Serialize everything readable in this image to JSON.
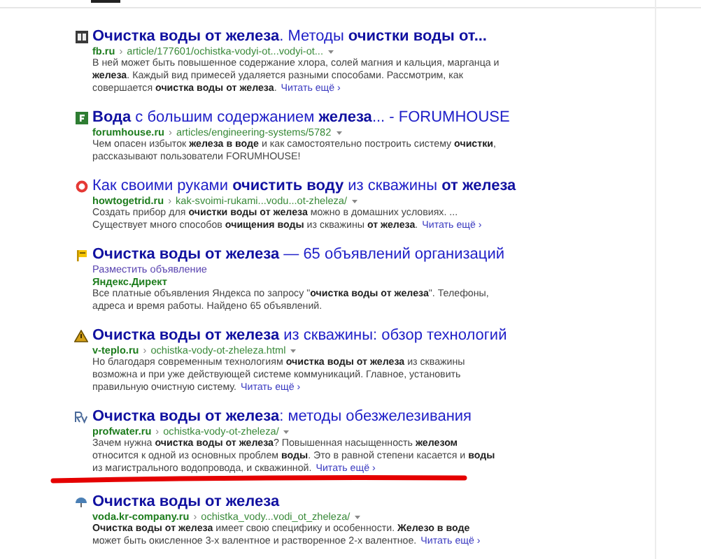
{
  "results": [
    {
      "kind": "organic",
      "title": "**Очистка воды от железа**. Методы **очистки воды от...**",
      "site": "fb.ru",
      "sep": "›",
      "path": "article/177601/ochistka-vodyi-ot...vodyi-ot...",
      "lines": [
        "В ней может быть повышенное содержание хлора, солей магния и кальция, марганца и",
        "**железа**. Каждый вид примесей удаляется разными способами. Рассмотрим, как",
        "совершается **очистка воды от железа**."
      ],
      "more": "Читать ещё ›"
    },
    {
      "kind": "organic",
      "title": "**Вода** с большим содержанием **железа**... - FORUMHOUSE",
      "site": "forumhouse.ru",
      "sep": "›",
      "path": "articles/engineering-systems/5782",
      "lines": [
        "Чем опасен избыток **железа в воде** и как самостоятельно построить систему **очистки**,",
        "рассказывают пользователи FORUMHOUSE!"
      ]
    },
    {
      "kind": "organic",
      "title": "Как своими руками **очистить воду** из скважины **от железа**",
      "site": "howtogetrid.ru",
      "sep": "›",
      "path": "kak-svoimi-rukami...vodu...ot-zheleza/",
      "lines": [
        "Создать прибор для **очистки воды от железа** можно в домашних условиях. ...",
        "Существует много способов **очищения воды** из скважины **от железа**."
      ],
      "more": "Читать ещё ›"
    },
    {
      "kind": "direct",
      "title": "**Очистка воды от железа** — 65 объявлений организаций",
      "link": "Разместить объявление",
      "source": "Яндекс.Директ",
      "lines": [
        "Все платные объявления Яндекса по запросу \"**очистка воды от железа**\". Телефоны,",
        "адреса и время работы. Найдено 65 объявлений."
      ]
    },
    {
      "kind": "organic",
      "title": "**Очистка воды от железа** из скважины: обзор технологий",
      "site": "v-teplo.ru",
      "sep": "›",
      "path": "ochistka-vody-ot-zheleza.html",
      "lines": [
        "Но благодаря современным технологиям **очистка воды от железа** из скважины",
        "возможна и при уже действующей системе коммуникаций. Главное, установить",
        "правильную очистную систему."
      ],
      "more": "Читать ещё ›"
    },
    {
      "kind": "organic",
      "title": "**Очистка воды от железа**: методы обезжелезивания",
      "site": "profwater.ru",
      "sep": "›",
      "path": "ochistka-vody-ot-zheleza/",
      "lines": [
        "Зачем нужна **очистка воды от железа**? Повышенная насыщенность **железом**",
        "относится к одной из основных проблем **воды**. Это в равной степени касается и **воды**",
        "из магистрального водопровода, и скважинной."
      ],
      "more": "Читать ещё ›"
    },
    {
      "kind": "organic",
      "title": "**Очистка воды от железа**",
      "site": "voda.kr-company.ru",
      "sep": "›",
      "path": "ochistka_vody...vodi_ot_zheleza/",
      "lines": [
        "**Очистка воды от железа** имеет свою специфику и особенности. **Железо в воде**",
        "может быть окисленное 3-х валентное и растворенное 2-х валентное."
      ],
      "more": "Читать ещё ›"
    }
  ]
}
